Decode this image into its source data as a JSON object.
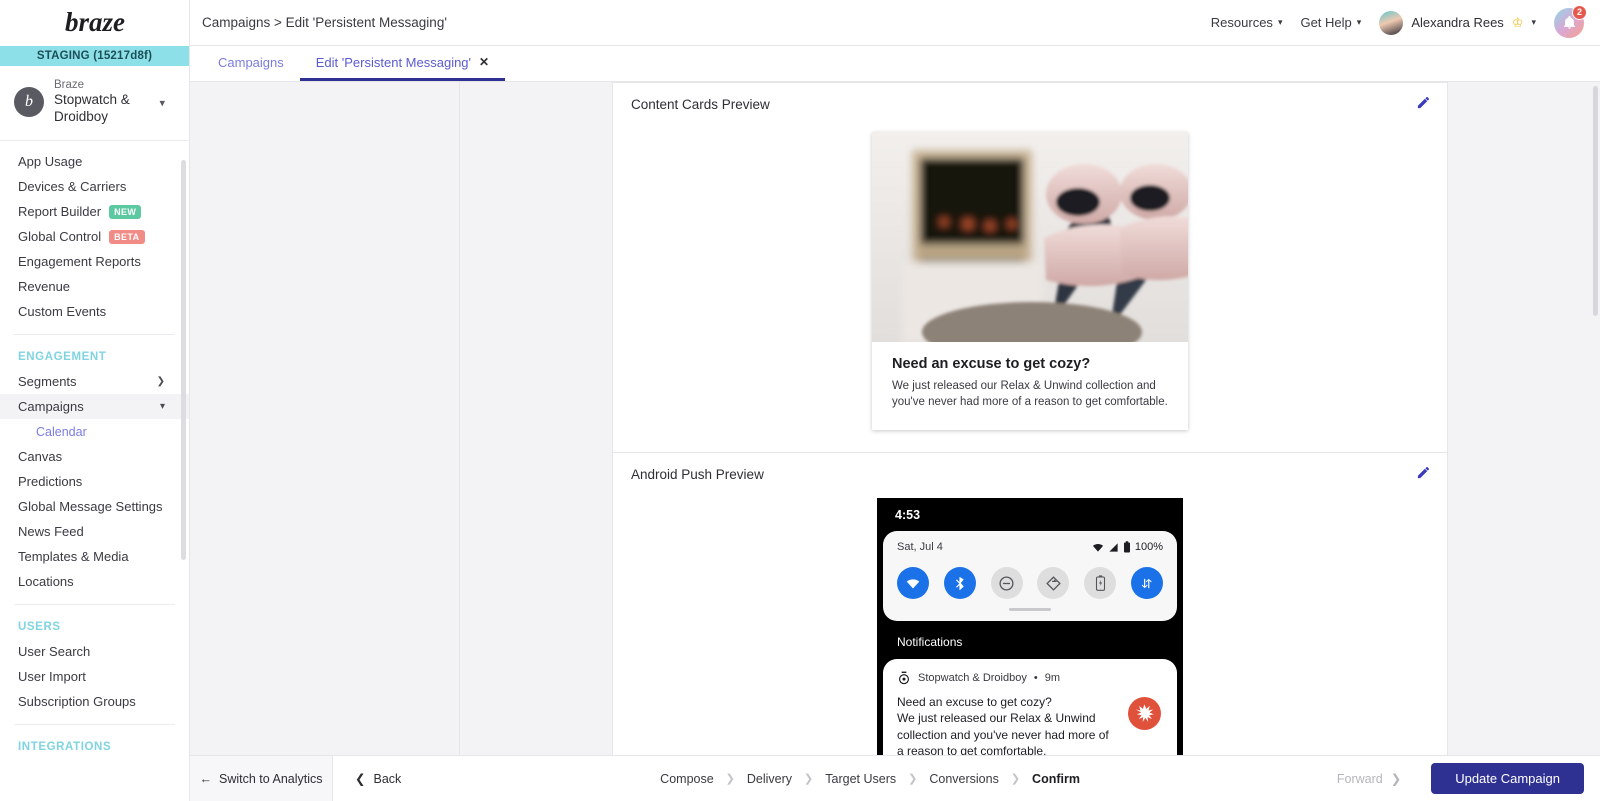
{
  "brand": {
    "logo_text": "braze",
    "staging_label": "STAGING (15217d8f)"
  },
  "workspace": {
    "company": "Braze",
    "app_group": "Stopwatch & Droidboy",
    "avatar_letter": "b"
  },
  "sidebar": {
    "top_items": [
      {
        "label": "App Usage"
      },
      {
        "label": "Devices & Carriers"
      },
      {
        "label": "Report Builder",
        "badge": "NEW",
        "badge_kind": "new"
      },
      {
        "label": "Global Control",
        "badge": "BETA",
        "badge_kind": "beta"
      },
      {
        "label": "Engagement Reports"
      },
      {
        "label": "Revenue"
      },
      {
        "label": "Custom Events"
      }
    ],
    "engagement_section": "ENGAGEMENT",
    "engagement_items": [
      {
        "label": "Segments",
        "chevron": "right"
      },
      {
        "label": "Campaigns",
        "chevron": "down",
        "active": true
      },
      {
        "label": "Calendar",
        "sub": true
      },
      {
        "label": "Canvas"
      },
      {
        "label": "Predictions"
      },
      {
        "label": "Global Message Settings"
      },
      {
        "label": "News Feed"
      },
      {
        "label": "Templates & Media"
      },
      {
        "label": "Locations"
      }
    ],
    "users_section": "USERS",
    "users_items": [
      {
        "label": "User Search"
      },
      {
        "label": "User Import"
      },
      {
        "label": "Subscription Groups"
      }
    ],
    "integrations_section": "INTEGRATIONS"
  },
  "topbar": {
    "breadcrumb": "Campaigns > Edit 'Persistent Messaging'",
    "resources_label": "Resources",
    "help_label": "Get Help",
    "user_name": "Alexandra Rees",
    "notification_count": "2"
  },
  "tabs": [
    {
      "label": "Campaigns",
      "active": false,
      "closable": false
    },
    {
      "label": "Edit 'Persistent Messaging'",
      "active": true,
      "closable": true
    }
  ],
  "content_cards_preview": {
    "title": "Content Cards Preview",
    "card_headline": "Need an excuse to get cozy?",
    "card_body": "We just released our Relax & Unwind collection and you've never had more of a reason to get comfortable."
  },
  "android_push_preview": {
    "title": "Android Push Preview",
    "status_time": "4:53",
    "quick_settings_date": "Sat, Jul 4",
    "battery_label": "100%",
    "notifications_label": "Notifications",
    "app_name": "Stopwatch & Droidboy",
    "time_ago": "9m",
    "push_title": "Need an excuse to get cozy?",
    "push_body": "We just released our Relax & Unwind collection and you've never had more of a reason to get comfortable.",
    "tiles": [
      {
        "name": "wifi",
        "state": "on"
      },
      {
        "name": "bluetooth",
        "state": "on"
      },
      {
        "name": "do-not-disturb",
        "state": "off"
      },
      {
        "name": "auto-rotate",
        "state": "off"
      },
      {
        "name": "battery-saver",
        "state": "off"
      },
      {
        "name": "mobile-data",
        "state": "on"
      }
    ]
  },
  "footer": {
    "switch_label": "Switch to Analytics",
    "back_label": "Back",
    "steps": [
      {
        "label": "Compose",
        "current": false
      },
      {
        "label": "Delivery",
        "current": false
      },
      {
        "label": "Target Users",
        "current": false
      },
      {
        "label": "Conversions",
        "current": false
      },
      {
        "label": "Confirm",
        "current": true
      }
    ],
    "forward_label": "Forward",
    "update_label": "Update Campaign"
  },
  "colors": {
    "accent_indigo": "#2f3192",
    "staging_teal": "#8ee0e8",
    "badge_new": "#5dc9a0",
    "badge_beta": "#f08b86",
    "notif_icon_red": "#e0513c",
    "tile_blue": "#1b72e8"
  }
}
